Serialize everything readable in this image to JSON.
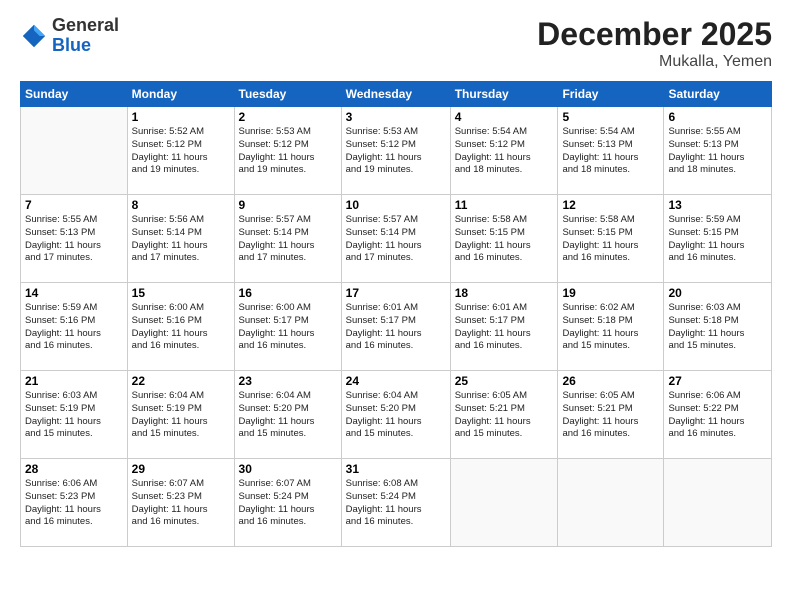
{
  "logo": {
    "general": "General",
    "blue": "Blue"
  },
  "header": {
    "month": "December 2025",
    "location": "Mukalla, Yemen"
  },
  "days_of_week": [
    "Sunday",
    "Monday",
    "Tuesday",
    "Wednesday",
    "Thursday",
    "Friday",
    "Saturday"
  ],
  "weeks": [
    [
      {
        "day": "",
        "info": ""
      },
      {
        "day": "1",
        "info": "Sunrise: 5:52 AM\nSunset: 5:12 PM\nDaylight: 11 hours\nand 19 minutes."
      },
      {
        "day": "2",
        "info": "Sunrise: 5:53 AM\nSunset: 5:12 PM\nDaylight: 11 hours\nand 19 minutes."
      },
      {
        "day": "3",
        "info": "Sunrise: 5:53 AM\nSunset: 5:12 PM\nDaylight: 11 hours\nand 19 minutes."
      },
      {
        "day": "4",
        "info": "Sunrise: 5:54 AM\nSunset: 5:12 PM\nDaylight: 11 hours\nand 18 minutes."
      },
      {
        "day": "5",
        "info": "Sunrise: 5:54 AM\nSunset: 5:13 PM\nDaylight: 11 hours\nand 18 minutes."
      },
      {
        "day": "6",
        "info": "Sunrise: 5:55 AM\nSunset: 5:13 PM\nDaylight: 11 hours\nand 18 minutes."
      }
    ],
    [
      {
        "day": "7",
        "info": "Sunrise: 5:55 AM\nSunset: 5:13 PM\nDaylight: 11 hours\nand 17 minutes."
      },
      {
        "day": "8",
        "info": "Sunrise: 5:56 AM\nSunset: 5:14 PM\nDaylight: 11 hours\nand 17 minutes."
      },
      {
        "day": "9",
        "info": "Sunrise: 5:57 AM\nSunset: 5:14 PM\nDaylight: 11 hours\nand 17 minutes."
      },
      {
        "day": "10",
        "info": "Sunrise: 5:57 AM\nSunset: 5:14 PM\nDaylight: 11 hours\nand 17 minutes."
      },
      {
        "day": "11",
        "info": "Sunrise: 5:58 AM\nSunset: 5:15 PM\nDaylight: 11 hours\nand 16 minutes."
      },
      {
        "day": "12",
        "info": "Sunrise: 5:58 AM\nSunset: 5:15 PM\nDaylight: 11 hours\nand 16 minutes."
      },
      {
        "day": "13",
        "info": "Sunrise: 5:59 AM\nSunset: 5:15 PM\nDaylight: 11 hours\nand 16 minutes."
      }
    ],
    [
      {
        "day": "14",
        "info": "Sunrise: 5:59 AM\nSunset: 5:16 PM\nDaylight: 11 hours\nand 16 minutes."
      },
      {
        "day": "15",
        "info": "Sunrise: 6:00 AM\nSunset: 5:16 PM\nDaylight: 11 hours\nand 16 minutes."
      },
      {
        "day": "16",
        "info": "Sunrise: 6:00 AM\nSunset: 5:17 PM\nDaylight: 11 hours\nand 16 minutes."
      },
      {
        "day": "17",
        "info": "Sunrise: 6:01 AM\nSunset: 5:17 PM\nDaylight: 11 hours\nand 16 minutes."
      },
      {
        "day": "18",
        "info": "Sunrise: 6:01 AM\nSunset: 5:17 PM\nDaylight: 11 hours\nand 16 minutes."
      },
      {
        "day": "19",
        "info": "Sunrise: 6:02 AM\nSunset: 5:18 PM\nDaylight: 11 hours\nand 15 minutes."
      },
      {
        "day": "20",
        "info": "Sunrise: 6:03 AM\nSunset: 5:18 PM\nDaylight: 11 hours\nand 15 minutes."
      }
    ],
    [
      {
        "day": "21",
        "info": "Sunrise: 6:03 AM\nSunset: 5:19 PM\nDaylight: 11 hours\nand 15 minutes."
      },
      {
        "day": "22",
        "info": "Sunrise: 6:04 AM\nSunset: 5:19 PM\nDaylight: 11 hours\nand 15 minutes."
      },
      {
        "day": "23",
        "info": "Sunrise: 6:04 AM\nSunset: 5:20 PM\nDaylight: 11 hours\nand 15 minutes."
      },
      {
        "day": "24",
        "info": "Sunrise: 6:04 AM\nSunset: 5:20 PM\nDaylight: 11 hours\nand 15 minutes."
      },
      {
        "day": "25",
        "info": "Sunrise: 6:05 AM\nSunset: 5:21 PM\nDaylight: 11 hours\nand 15 minutes."
      },
      {
        "day": "26",
        "info": "Sunrise: 6:05 AM\nSunset: 5:21 PM\nDaylight: 11 hours\nand 16 minutes."
      },
      {
        "day": "27",
        "info": "Sunrise: 6:06 AM\nSunset: 5:22 PM\nDaylight: 11 hours\nand 16 minutes."
      }
    ],
    [
      {
        "day": "28",
        "info": "Sunrise: 6:06 AM\nSunset: 5:23 PM\nDaylight: 11 hours\nand 16 minutes."
      },
      {
        "day": "29",
        "info": "Sunrise: 6:07 AM\nSunset: 5:23 PM\nDaylight: 11 hours\nand 16 minutes."
      },
      {
        "day": "30",
        "info": "Sunrise: 6:07 AM\nSunset: 5:24 PM\nDaylight: 11 hours\nand 16 minutes."
      },
      {
        "day": "31",
        "info": "Sunrise: 6:08 AM\nSunset: 5:24 PM\nDaylight: 11 hours\nand 16 minutes."
      },
      {
        "day": "",
        "info": ""
      },
      {
        "day": "",
        "info": ""
      },
      {
        "day": "",
        "info": ""
      }
    ]
  ]
}
